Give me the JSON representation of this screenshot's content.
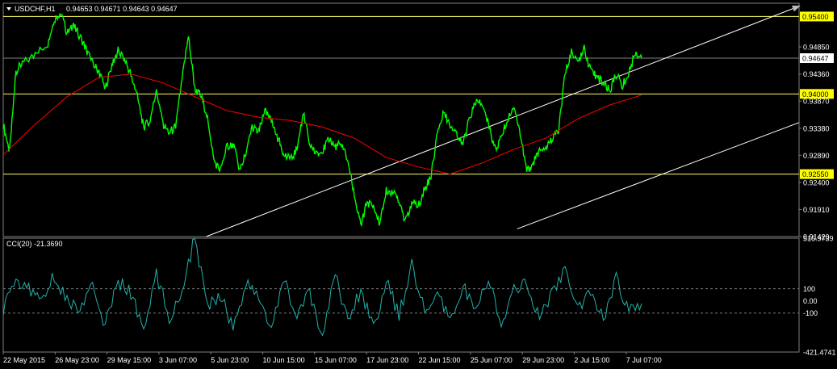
{
  "header": {
    "symbol": "USDCHF,H1",
    "ohlc": "0.94653 0.94671 0.94643 0.94647",
    "cci_label": "CCI(20) -21.3690"
  },
  "colors": {
    "background": "#000000",
    "price": "#00ff00",
    "ma": "#ff0000",
    "channel": "#ffffff",
    "hline": "#ffff66",
    "cci": "#20b2aa",
    "tag_bg": "#ffff00",
    "grid": "#808080"
  },
  "chart_data": [
    {
      "type": "line",
      "title": "USDCHF,H1",
      "ylim": [
        0.9142,
        0.9564
      ],
      "y_ticks": [
        0.9485,
        0.9436,
        0.9387,
        0.9338,
        0.9289,
        0.924,
        0.9191,
        0.9142
      ],
      "y_tick_labels": [
        "0.94850",
        "0.94360",
        "0.93870",
        "0.93380",
        "0.92890",
        "0.92400",
        "0.91910",
        "0.91420"
      ],
      "x_tick_labels": [
        "22 May 2015",
        "26 May 23:00",
        "29 May 15:00",
        "3 Jun 07:00",
        "5 Jun 23:00",
        "10 Jun 15:00",
        "15 Jun 07:00",
        "17 Jun 23:00",
        "22 Jun 15:00",
        "25 Jun 07:00",
        "29 Jun 23:00",
        "2 Jul 15:00",
        "7 Jul 07:00"
      ],
      "x_tick_pos": [
        0,
        0.0813,
        0.1626,
        0.2439,
        0.3252,
        0.4065,
        0.4878,
        0.5691,
        0.6504,
        0.7317,
        0.813,
        0.8943,
        0.9756
      ],
      "series": [
        {
          "role": "price",
          "x": [
            0,
            0.01,
            0.02,
            0.03,
            0.05,
            0.07,
            0.08,
            0.09,
            0.1,
            0.11,
            0.12,
            0.13,
            0.14,
            0.15,
            0.16,
            0.17,
            0.18,
            0.19,
            0.2,
            0.21,
            0.22,
            0.23,
            0.24,
            0.25,
            0.26,
            0.27,
            0.28,
            0.29,
            0.3,
            0.31,
            0.32,
            0.33,
            0.34,
            0.35,
            0.36,
            0.37,
            0.38,
            0.39,
            0.4,
            0.41,
            0.42,
            0.43,
            0.44,
            0.45,
            0.46,
            0.47,
            0.48,
            0.49,
            0.5,
            0.51,
            0.52,
            0.53,
            0.54,
            0.55,
            0.56,
            0.57,
            0.58,
            0.59,
            0.6,
            0.61,
            0.62,
            0.63,
            0.64,
            0.65,
            0.66,
            0.67,
            0.68,
            0.69,
            0.7,
            0.71,
            0.72,
            0.73,
            0.74,
            0.75,
            0.76,
            0.77,
            0.78,
            0.79,
            0.8,
            0.81,
            0.82,
            0.83,
            0.84,
            0.85,
            0.86,
            0.87,
            0.88,
            0.89,
            0.9,
            0.91,
            0.92,
            0.93,
            0.94,
            0.95,
            0.96,
            0.97,
            0.98,
            0.99,
            1.0
          ],
          "values": [
            0.9345,
            0.9295,
            0.9442,
            0.9455,
            0.947,
            0.9492,
            0.9535,
            0.9548,
            0.951,
            0.9522,
            0.9505,
            0.948,
            0.9455,
            0.944,
            0.941,
            0.9452,
            0.9478,
            0.9463,
            0.9435,
            0.9395,
            0.934,
            0.9352,
            0.9408,
            0.9345,
            0.933,
            0.934,
            0.9425,
            0.9505,
            0.941,
            0.9395,
            0.936,
            0.928,
            0.926,
            0.9305,
            0.931,
            0.9265,
            0.929,
            0.934,
            0.933,
            0.9368,
            0.935,
            0.932,
            0.929,
            0.928,
            0.93,
            0.9365,
            0.931,
            0.929,
            0.9295,
            0.932,
            0.9305,
            0.931,
            0.928,
            0.9215,
            0.916,
            0.9205,
            0.9195,
            0.9165,
            0.9225,
            0.922,
            0.921,
            0.9168,
            0.9205,
            0.9195,
            0.923,
            0.925,
            0.933,
            0.9365,
            0.9345,
            0.933,
            0.931,
            0.9355,
            0.9385,
            0.938,
            0.9345,
            0.93,
            0.932,
            0.9355,
            0.938,
            0.9325,
            0.926,
            0.9275,
            0.9295,
            0.93,
            0.932,
            0.9335,
            0.9435,
            0.948,
            0.9455,
            0.9485,
            0.944,
            0.943,
            0.942,
            0.9405,
            0.9435,
            0.9415,
            0.9438,
            0.9475,
            0.9465
          ]
        },
        {
          "role": "moving-average",
          "x": [
            0,
            0.05,
            0.1,
            0.15,
            0.2,
            0.25,
            0.3,
            0.35,
            0.4,
            0.45,
            0.5,
            0.55,
            0.6,
            0.65,
            0.7,
            0.75,
            0.8,
            0.85,
            0.9,
            0.95,
            1.0
          ],
          "values": [
            0.929,
            0.9345,
            0.9395,
            0.943,
            0.9436,
            0.942,
            0.9395,
            0.937,
            0.9358,
            0.9352,
            0.934,
            0.932,
            0.9285,
            0.9268,
            0.9255,
            0.9275,
            0.93,
            0.932,
            0.9355,
            0.938,
            0.9398
          ]
        }
      ],
      "hlines": [
        0.954,
        0.94647,
        0.94,
        0.9255
      ],
      "hline_labels": [
        "0.95400",
        "0.94647",
        "0.94000",
        "0.92550"
      ],
      "channel": [
        {
          "x1": 0.2551,
          "y1": 0.9142,
          "x2": 1.0097,
          "y2": 0.9564
        },
        {
          "x1": 0.6458,
          "y1": 0.9156,
          "x2": 1.2521,
          "y2": 0.9485
        }
      ]
    },
    {
      "type": "line",
      "title": "CCI(20) -21.3690",
      "ylim": [
        -421.4741,
        516.9739
      ],
      "y_ticks": [
        516.9739,
        100,
        0,
        -100,
        -421.4741
      ],
      "y_tick_labels": [
        "516.9739",
        "100",
        "0.00",
        "-100",
        "-421.4741"
      ],
      "dashed_levels": [
        100,
        -100
      ],
      "series": [
        {
          "role": "cci",
          "x": [
            0,
            0.02,
            0.04,
            0.06,
            0.08,
            0.1,
            0.12,
            0.14,
            0.16,
            0.18,
            0.2,
            0.22,
            0.24,
            0.26,
            0.28,
            0.3,
            0.32,
            0.34,
            0.36,
            0.38,
            0.4,
            0.42,
            0.44,
            0.46,
            0.48,
            0.5,
            0.52,
            0.54,
            0.56,
            0.58,
            0.6,
            0.62,
            0.64,
            0.66,
            0.68,
            0.7,
            0.72,
            0.74,
            0.76,
            0.78,
            0.8,
            0.82,
            0.84,
            0.86,
            0.88,
            0.9,
            0.92,
            0.94,
            0.96,
            0.98,
            1.0
          ],
          "values": [
            -60,
            180,
            90,
            40,
            200,
            10,
            -80,
            120,
            -200,
            160,
            70,
            -260,
            220,
            -150,
            100,
            520,
            -60,
            60,
            -220,
            140,
            40,
            -250,
            180,
            -130,
            60,
            -300,
            220,
            -160,
            90,
            -210,
            160,
            -120,
            300,
            -90,
            50,
            -180,
            140,
            -110,
            210,
            -240,
            120,
            130,
            -160,
            90,
            240,
            -70,
            60,
            -140,
            190,
            -90,
            -21
          ]
        }
      ]
    }
  ]
}
